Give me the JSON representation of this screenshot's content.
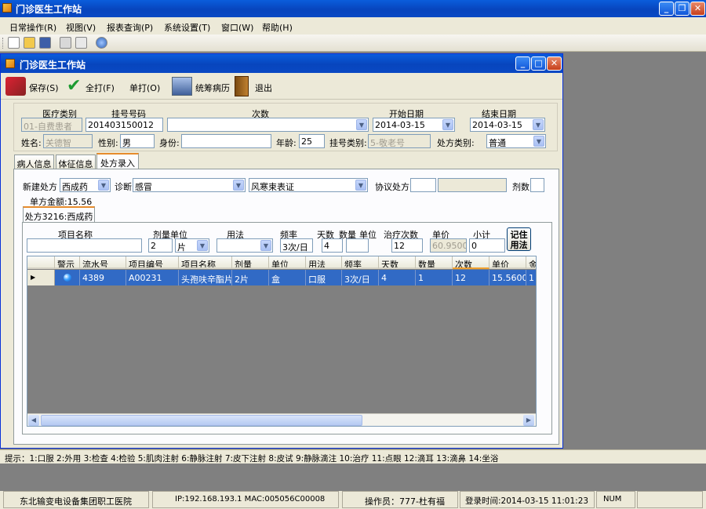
{
  "app": {
    "title": "门诊医生工作站"
  },
  "menu": [
    {
      "label": "日常操作(R)"
    },
    {
      "label": "视图(V)"
    },
    {
      "label": "报表查询(P)"
    },
    {
      "label": "系统设置(T)"
    },
    {
      "label": "窗口(W)"
    },
    {
      "label": "帮助(H)"
    }
  ],
  "child": {
    "title": "门诊医生工作站",
    "toolbar": {
      "save": "保存(S)",
      "print_all": "全打(F)",
      "print_single": "单打(O)",
      "records": "统筹病历",
      "exit": "退出"
    }
  },
  "patient": {
    "med_type_label": "医疗类别",
    "med_type_value": "01-自费患者",
    "reg_no_label": "挂号号码",
    "reg_no_value": "201403150012",
    "times_label": "次数",
    "times_value": "",
    "start_label": "开始日期",
    "start_value": "2014-03-15",
    "end_label": "结束日期",
    "end_value": "2014-03-15",
    "name_label": "姓名:",
    "name_value": "关德智",
    "gender_label": "性别:",
    "gender_value": "男",
    "id_label": "身份:",
    "id_value": "",
    "age_label": "年龄:",
    "age_value": "25",
    "reg_type_label": "挂号类别:",
    "reg_type_value": "5-敬老号",
    "rx_type_label": "处方类别:",
    "rx_type_value": "普通"
  },
  "tabs": [
    {
      "label": "病人信息"
    },
    {
      "label": "体征信息"
    },
    {
      "label": "处方录入"
    }
  ],
  "rx": {
    "new_label": "新建处方",
    "new_value": "西成药",
    "diag_label": "诊断",
    "diag_value": "感冒",
    "syndrome_value": "风寒束表证",
    "agree_label": "协议处方",
    "agree_value": "",
    "dose_label": "剂数",
    "dose_value": "",
    "amount": "单方金额:15.56",
    "sub_tab": "处方3216:西成药"
  },
  "entry": {
    "item_name_label": "项目名称",
    "dose_unit_label": "剂量单位",
    "usage_label": "用法",
    "freq_label": "频率",
    "days_label": "天数",
    "qty_label": "数量",
    "unit_label": "单位",
    "treat_label": "治疗次数",
    "price_label": "单价",
    "subtotal_label": "小计",
    "record_btn": "记住用法",
    "item_name_value": "",
    "dose_value": "2",
    "dose_unit_value": "片",
    "usage_value": "",
    "freq_value": "3次/日",
    "days_value": "4",
    "qty_value": "",
    "treat_value": "12",
    "price_value": "60.9500",
    "subtotal_value": "0"
  },
  "grid": {
    "columns": [
      "警示",
      "流水号",
      "项目编号",
      "项目名称",
      "剂量",
      "单位",
      "用法",
      "频率",
      "天数",
      "数量",
      "次数",
      "单价",
      "金"
    ],
    "rows": [
      [
        "",
        "4389",
        "A00231",
        "头孢呋辛酯片",
        "2片",
        "盒",
        "口服",
        "3次/日",
        "4",
        "1",
        "12",
        "15.5600",
        "1"
      ]
    ]
  },
  "hint": "提示：1:口服 2:外用 3:检查 4:检验 5:肌肉注射 6:静脉注射 7:皮下注射 8:皮试 9:静脉滴注 10:治疗 11:点眼 12:滴耳 13:滴鼻 14:坐浴",
  "status": {
    "org": "东北输变电设备集团职工医院",
    "ip": "IP:192.168.193.1  MAC:005056C00008",
    "operator": "操作员：777-杜有福",
    "login": "登录时间:2014-03-15 11:01:23",
    "num": "NUM"
  },
  "colors": {
    "selection": "#316ac5",
    "title_blue": "#0a5ddc",
    "tab_highlight": "#e68b2c"
  }
}
